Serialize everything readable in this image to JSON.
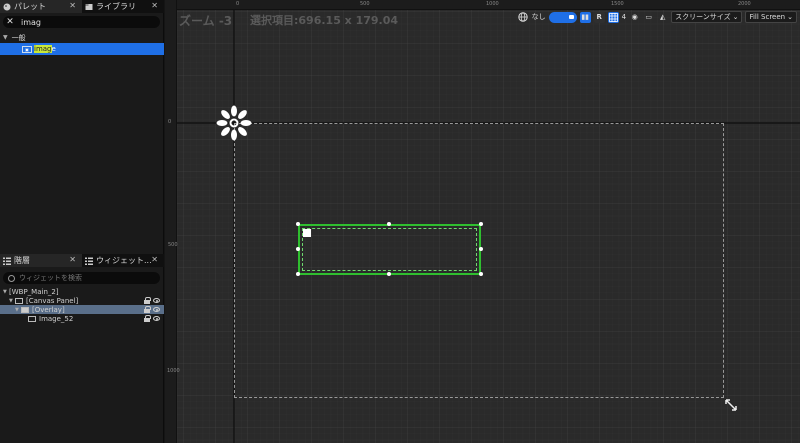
{
  "palette": {
    "tabs": [
      {
        "label": "パレット",
        "icon": "palette-icon",
        "active": true
      },
      {
        "label": "ライブラリ",
        "icon": "library-icon",
        "active": false
      }
    ],
    "search_value": "imag",
    "category": "一般",
    "item_label_highlight": "imag",
    "item_label_rest": "e",
    "item_icon": "image-icon"
  },
  "hierarchy": {
    "tabs": [
      {
        "label": "階層",
        "icon": "hierarchy-icon",
        "active": true
      },
      {
        "label": "ウィジェット...",
        "icon": "widget-icon",
        "active": false
      }
    ],
    "search_placeholder": "ウィジェットを検索",
    "tree": [
      {
        "label": "[WBP_Main_2]",
        "depth": 0,
        "selected": false
      },
      {
        "label": "[Canvas Panel]",
        "depth": 1,
        "selected": false
      },
      {
        "label": "[Overlay]",
        "depth": 2,
        "selected": true
      },
      {
        "label": "Image_52",
        "depth": 3,
        "selected": false
      }
    ]
  },
  "designer": {
    "zoom_label": "ズーム -3",
    "selection_label": "選択項目:696.15 x 179.04",
    "ruler_top": [
      "0",
      "500",
      "1000",
      "1500",
      "2000"
    ],
    "ruler_left": [
      "0",
      "500",
      "1000"
    ],
    "toolbar": {
      "none_label": "なし",
      "r_label": "R",
      "grid_count": "4",
      "screen_size_label": "スクリーンサイズ",
      "fill_screen_label": "Fill Screen"
    }
  },
  "colors": {
    "accent": "#1f6fe6",
    "selection_border": "#2fbf2f",
    "tree_selected": "#5a6f8a"
  }
}
